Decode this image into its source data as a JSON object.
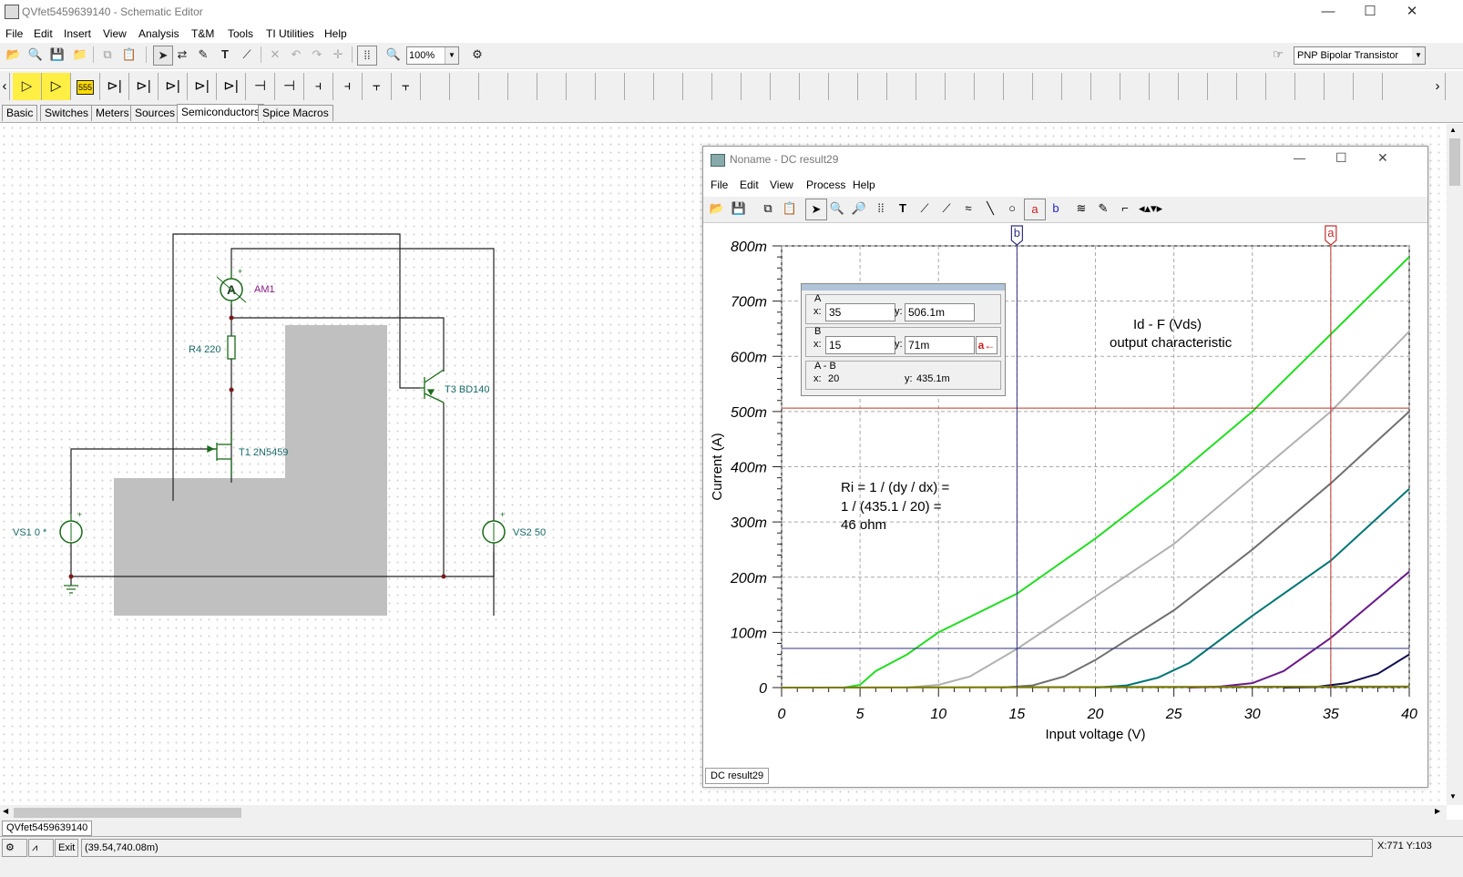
{
  "app": {
    "title": "QVfet5459639140 - Schematic Editor",
    "window_buttons": {
      "minimize": "—",
      "maximize": "☐",
      "close": "✕"
    }
  },
  "menu": [
    "File",
    "Edit",
    "Insert",
    "View",
    "Analysis",
    "T&M",
    "Tools",
    "TI Utilities",
    "Help"
  ],
  "toolbar": {
    "zoom": "100%",
    "component_select": "PNP Bipolar Transistor"
  },
  "component_tabs": [
    "Basic",
    "Switches",
    "Meters",
    "Sources",
    "Semiconductors",
    "Spice Macros"
  ],
  "active_tab": "Semiconductors",
  "schematic": {
    "labels": {
      "am1": "AM1",
      "am1_letter": "A",
      "r4": "R4 220",
      "t3": "T3 BD140",
      "t1": "T1 2N5459",
      "vs1": "VS1 0 *",
      "vs2": "VS2 50",
      "plus": "+",
      "minus": "-",
      "chip555": "555"
    }
  },
  "result_window": {
    "title": "Noname - DC result29",
    "menu": [
      "File",
      "Edit",
      "View",
      "Process",
      "Help"
    ],
    "sheet_tab": "DC result29",
    "cursor_box": {
      "a_label": "A",
      "a_x": "35",
      "a_y": "506.1m",
      "b_label": "B",
      "b_x": "15",
      "b_y": "71m",
      "diff_label": "A - B",
      "diff_x": "20",
      "diff_y": "435.1m",
      "x_prefix": "x:",
      "y_prefix": "y:",
      "a_btn": "a←"
    },
    "cursor_a_tag": "a",
    "cursor_b_tag": "b",
    "annotation_title_1": "Id - F (Vds)",
    "annotation_title_2": "output characteristic",
    "ri_line1": "Ri = 1 / (dy / dx) =",
    "ri_line2": "1 / (435.1 / 20) =",
    "ri_line3": "46 ohm"
  },
  "chart_data": {
    "type": "line",
    "xlabel": "Input voltage (V)",
    "ylabel": "Current (A)",
    "xlim": [
      0,
      40
    ],
    "ylim": [
      0,
      0.8
    ],
    "x_ticks": [
      "0",
      "5",
      "10",
      "15",
      "20",
      "25",
      "30",
      "35",
      "40"
    ],
    "y_ticks": [
      "0",
      "100m",
      "200m",
      "300m",
      "400m",
      "500m",
      "600m",
      "700m",
      "800m"
    ],
    "grid": true,
    "cursors": {
      "a": {
        "x": 35,
        "y": 0.5061
      },
      "b": {
        "x": 15,
        "y": 0.071
      }
    },
    "series": [
      {
        "color": "#22dd22",
        "x": [
          4,
          5,
          6,
          8,
          10,
          15,
          20,
          25,
          30,
          35,
          40
        ],
        "y": [
          0,
          0.005,
          0.03,
          0.06,
          0.1,
          0.17,
          0.27,
          0.38,
          0.5,
          0.64,
          0.78
        ]
      },
      {
        "color": "#b0b0b0",
        "x": [
          8,
          10,
          12,
          15,
          20,
          25,
          30,
          35,
          40
        ],
        "y": [
          0,
          0.005,
          0.02,
          0.07,
          0.165,
          0.26,
          0.38,
          0.5,
          0.645
        ]
      },
      {
        "color": "#707070",
        "x": [
          14,
          16,
          18,
          20,
          25,
          30,
          35,
          40
        ],
        "y": [
          0,
          0.004,
          0.02,
          0.05,
          0.14,
          0.25,
          0.37,
          0.5
        ]
      },
      {
        "color": "#007575",
        "x": [
          20,
          22,
          24,
          26,
          30,
          35,
          40
        ],
        "y": [
          0,
          0.004,
          0.018,
          0.045,
          0.13,
          0.23,
          0.36
        ]
      },
      {
        "color": "#6a1a8a",
        "x": [
          26,
          28,
          30,
          32,
          35,
          40
        ],
        "y": [
          0,
          0.002,
          0.008,
          0.03,
          0.09,
          0.21
        ]
      },
      {
        "color": "#101050",
        "x": [
          32,
          34,
          36,
          38,
          40
        ],
        "y": [
          0,
          0.001,
          0.008,
          0.025,
          0.06
        ]
      },
      {
        "color": "#7a7a00",
        "x": [
          0,
          40
        ],
        "y": [
          0,
          0.002
        ]
      }
    ]
  },
  "status": {
    "sheet_tab": "QVfet5459639140",
    "exit": "Exit",
    "coords": "(39.54,740.08m)",
    "xy": "X:771 Y:103"
  }
}
